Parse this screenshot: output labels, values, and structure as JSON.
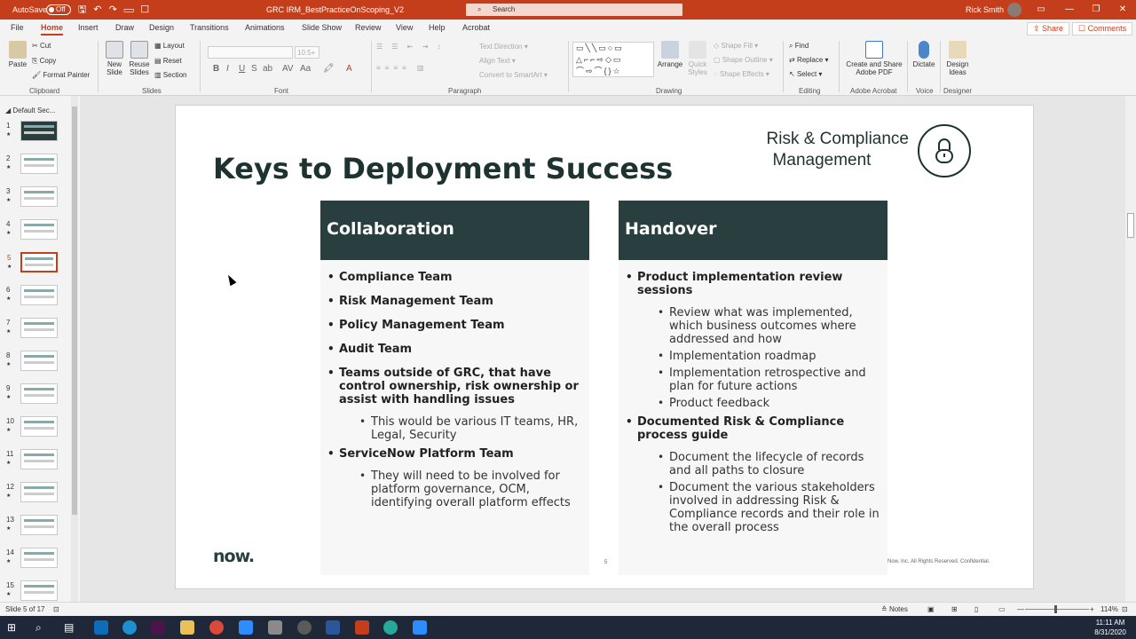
{
  "titlebar": {
    "autosave_label": "AutoSave",
    "autosave_state": "Off",
    "document_title": "GRC IRM_BestPracticeOnScoping_V2",
    "search_placeholder": "Search",
    "user_name": "Rick Smith",
    "minimize": "—",
    "restore": "❐",
    "close": "✕",
    "ribbon_display": "▭",
    "color": "#c43e1c"
  },
  "tabs": [
    "File",
    "Home",
    "Insert",
    "Draw",
    "Design",
    "Transitions",
    "Animations",
    "Slide Show",
    "Review",
    "View",
    "Help",
    "Acrobat"
  ],
  "active_tab": "Home",
  "share_label": "Share",
  "comments_label": "Comments",
  "ribbon": {
    "clipboard": {
      "paste": "Paste",
      "cut": "Cut",
      "copy": "Copy",
      "format_painter": "Format Painter",
      "label": "Clipboard"
    },
    "slides": {
      "new_slide": "New Slide",
      "reuse_slides": "Reuse Slides",
      "layout": "Layout",
      "reset": "Reset",
      "section": "Section",
      "label": "Slides"
    },
    "font": {
      "size": "10.5+",
      "label": "Font",
      "buttons": [
        "B",
        "I",
        "U",
        "S",
        "ab",
        "AV",
        "Aa",
        "A"
      ]
    },
    "paragraph": {
      "text_direction": "Text Direction",
      "align_text": "Align Text",
      "convert_smartart": "Convert to SmartArt",
      "label": "Paragraph"
    },
    "drawing": {
      "arrange": "Arrange",
      "quick_styles": "Quick Styles",
      "shape_fill": "Shape Fill",
      "shape_outline": "Shape Outline",
      "shape_effects": "Shape Effects",
      "label": "Drawing",
      "shapes": "▭╲╲▭○▭ △⌐⌐⇨◇▭ ⌒⇨⌒{}☆"
    },
    "editing": {
      "find": "Find",
      "replace": "Replace",
      "select": "Select",
      "label": "Editing"
    },
    "acrobat": {
      "create_share": "Create and Share Adobe PDF",
      "label": "Adobe Acrobat"
    },
    "voice": {
      "dictate": "Dictate",
      "label": "Voice"
    },
    "designer": {
      "design_ideas": "Design Ideas",
      "label": "Designer"
    }
  },
  "thumbnails": {
    "section_label": "Default Sec...",
    "count": 15,
    "selected": 5
  },
  "slide": {
    "title": "Keys to Deployment Success",
    "brand_line1": "Risk & Compliance",
    "brand_line2": "Management",
    "lock_icon": "lock-icon",
    "col1": {
      "heading": "Collaboration",
      "items": [
        {
          "text": "Compliance Team",
          "level": 1
        },
        {
          "text": "Risk Management Team",
          "level": 1
        },
        {
          "text": "Policy Management Team",
          "level": 1
        },
        {
          "text": "Audit Team",
          "level": 1
        },
        {
          "text": "Teams outside of GRC, that have control ownership, risk ownership or assist with handling issues",
          "level": 1
        },
        {
          "text": "This would be various IT teams, HR, Legal, Security",
          "level": 2
        },
        {
          "text": "ServiceNow Platform Team",
          "level": 1
        },
        {
          "text": "They will need to be involved for platform governance, OCM, identifying overall platform effects",
          "level": 2
        }
      ]
    },
    "col2": {
      "heading": "Handover",
      "items": [
        {
          "text": "Product implementation review sessions",
          "level": 1
        },
        {
          "text": "Review what was implemented, which business outcomes where addressed and how",
          "level": 2
        },
        {
          "text": "Implementation roadmap",
          "level": 2
        },
        {
          "text": "Implementation retrospective and plan for future actions",
          "level": 2
        },
        {
          "text": "Product feedback",
          "level": 2
        },
        {
          "text": "Documented Risk & Compliance process guide",
          "level": 1
        },
        {
          "text": "Document the lifecycle of records and all paths to closure",
          "level": 2
        },
        {
          "text": "Document the various stakeholders involved in addressing Risk & Compliance records and their role in the overall process",
          "level": 2
        }
      ]
    },
    "logo_text": "now.",
    "page_number": "5",
    "copyright": "Now, Inc. All Rights Reserved. Confidential.",
    "header_color": "#293e3e"
  },
  "status": {
    "slide_counter": "Slide 5 of 17",
    "notes": "Notes",
    "zoom": "114%",
    "plus": "+",
    "minus": "—"
  },
  "clock": {
    "time": "11:11 AM",
    "date": "8/31/2020"
  }
}
